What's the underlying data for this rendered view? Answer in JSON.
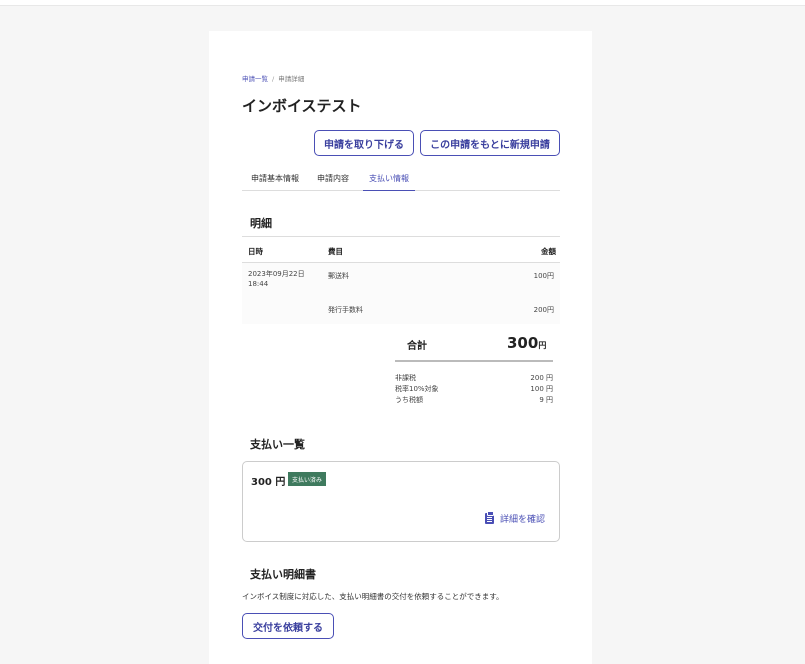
{
  "breadcrumb": {
    "list_link": "申請一覧",
    "separator": "/",
    "current": "申請詳細"
  },
  "page_title": "インボイステスト",
  "actions": {
    "withdraw_label": "申請を取り下げる",
    "new_from_this_label": "この申請をもとに新規申請"
  },
  "tabs": [
    {
      "label": "申請基本情報",
      "active": false
    },
    {
      "label": "申請内容",
      "active": false
    },
    {
      "label": "支払い情報",
      "active": true
    }
  ],
  "meisai": {
    "heading": "明細",
    "columns": {
      "date": "日時",
      "item": "費目",
      "amount": "金額"
    },
    "rows": [
      {
        "date_line1": "2023年09月22日",
        "date_line2": "18:44",
        "item": "郵送料",
        "amount": "100円"
      },
      {
        "date_line1": "",
        "date_line2": "",
        "item": "発行手数料",
        "amount": "200円"
      }
    ],
    "total_label": "合計",
    "total_value": "300",
    "total_unit": "円",
    "tax": [
      {
        "label": "非課税",
        "value": "200 円"
      },
      {
        "label": "税率10%対象",
        "value": "100 円"
      },
      {
        "label": "うち税額",
        "value": "9 円"
      }
    ]
  },
  "payments": {
    "heading": "支払い一覧",
    "amount": "300 円",
    "status_badge": "支払い済み",
    "detail_link": "詳細を確認",
    "icon": "clipboard-icon"
  },
  "statement": {
    "heading": "支払い明細書",
    "description": "インボイス制度に対応した、支払い明細書の交付を依頼することができます。",
    "request_button": "交付を依頼する"
  },
  "colors": {
    "accent": "#4a4fb5",
    "paid_badge": "#3f7a5e",
    "background": "#f6f6f6"
  }
}
